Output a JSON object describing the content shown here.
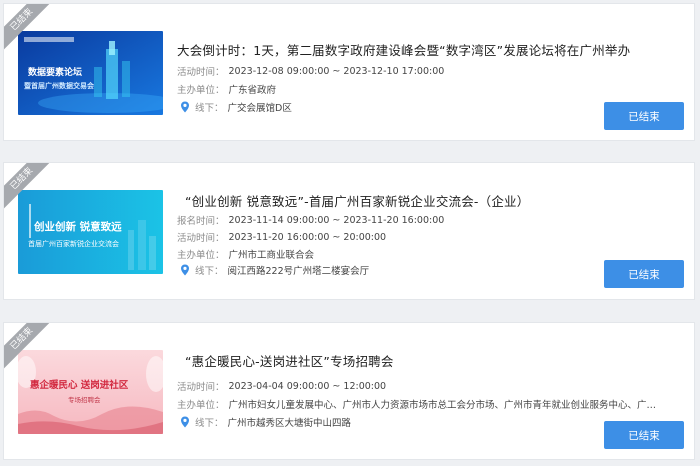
{
  "labels": {
    "registration_time": "报名时间：",
    "event_time": "活动时间：",
    "organizer": "主办单位：",
    "offline": "线下：",
    "ended_ribbon": "已结束",
    "ended_button": "已结束"
  },
  "events": [
    {
      "title": "大会倒计时：1天，第二届数字政府建设峰会暨“数字湾区”发展论坛将在广州举办",
      "event_time": "2023-12-08 09:00:00 ~ 2023-12-10 17:00:00",
      "organizer": "广东省政府",
      "location": "广交会展馆D区",
      "poster_text": [
        "数据要素论坛",
        "暨首届广州数据交易会"
      ]
    },
    {
      "title": "“创业创新 锐意致远”-首届广州百家新锐企业交流会-（企业）",
      "registration_time": "2023-11-14 09:00:00 ~ 2023-11-20 16:00:00",
      "event_time": "2023-11-20 16:00:00 ~ 20:00:00",
      "organizer": "广州市工商业联合会",
      "location": "阅江西路222号广州塔二楼宴会厅",
      "poster_text": [
        "创业创新 锐意致远",
        "首届广州百家新锐企业交流会"
      ]
    },
    {
      "title": "“惠企暖民心-送岗进社区”专场招聘会",
      "event_time": "2023-04-04 09:00:00 ~ 12:00:00",
      "organizer": "广州市妇女儿童发展中心、广州市人力资源市场市总工会分市场、广州市青年就业创业服务中心、广州市...",
      "location": "广州市越秀区大塘街中山四路",
      "poster_text": [
        "惠企暖民心 送岗进社区",
        "专场招聘会"
      ]
    }
  ],
  "colors": {
    "button": "#3d8fe6",
    "ribbon": "#a6a9ae",
    "location_icon": "#3d8fe6"
  }
}
